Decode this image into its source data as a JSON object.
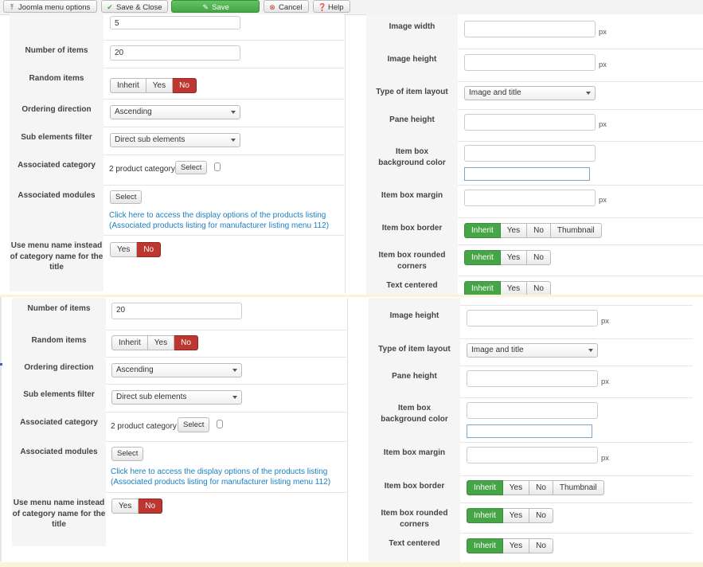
{
  "toolbar": {
    "menu_options": "Joomla menu options",
    "save_close": "Save & Close",
    "save": "Save",
    "cancel": "Cancel",
    "help": "Help"
  },
  "left": {
    "top_partial_value": "5",
    "number_of_items": {
      "label": "Number of items",
      "value": "20"
    },
    "random_items": {
      "label": "Random items",
      "options": [
        "Inherit",
        "Yes",
        "No"
      ],
      "selected": "No"
    },
    "ordering_direction": {
      "label": "Ordering direction",
      "value": "Ascending"
    },
    "sub_elements_filter": {
      "label": "Sub elements filter",
      "value": "Direct sub elements"
    },
    "associated_category": {
      "label": "Associated category",
      "value": "2 product category",
      "button": "Select"
    },
    "associated_modules": {
      "label": "Associated modules",
      "button": "Select",
      "link_line1": "Click here to access the display options of the products listing",
      "link_line2": "(Associated products listing for manufacturer listing menu 112)"
    },
    "use_menu_name": {
      "label": "Use menu name instead of category name for the title",
      "options": [
        "Yes",
        "No"
      ],
      "selected": "No"
    }
  },
  "right": {
    "image_width": {
      "label": "Image width",
      "unit": "px"
    },
    "image_height": {
      "label": "Image height",
      "unit": "px"
    },
    "item_layout": {
      "label": "Type of item layout",
      "value": "Image and title"
    },
    "pane_height": {
      "label": "Pane height",
      "unit": "px"
    },
    "bg_color": {
      "label": "Item box background color"
    },
    "margin": {
      "label": "Item box margin",
      "unit": "px"
    },
    "border": {
      "label": "Item box border",
      "options": [
        "Inherit",
        "Yes",
        "No",
        "Thumbnail"
      ],
      "selected": "Inherit"
    },
    "rounded": {
      "label": "Item box rounded corners",
      "options": [
        "Inherit",
        "Yes",
        "No"
      ],
      "selected": "Inherit"
    },
    "centered": {
      "label": "Text centered",
      "options": [
        "Inherit",
        "Yes",
        "No"
      ],
      "selected": "Inherit"
    }
  }
}
